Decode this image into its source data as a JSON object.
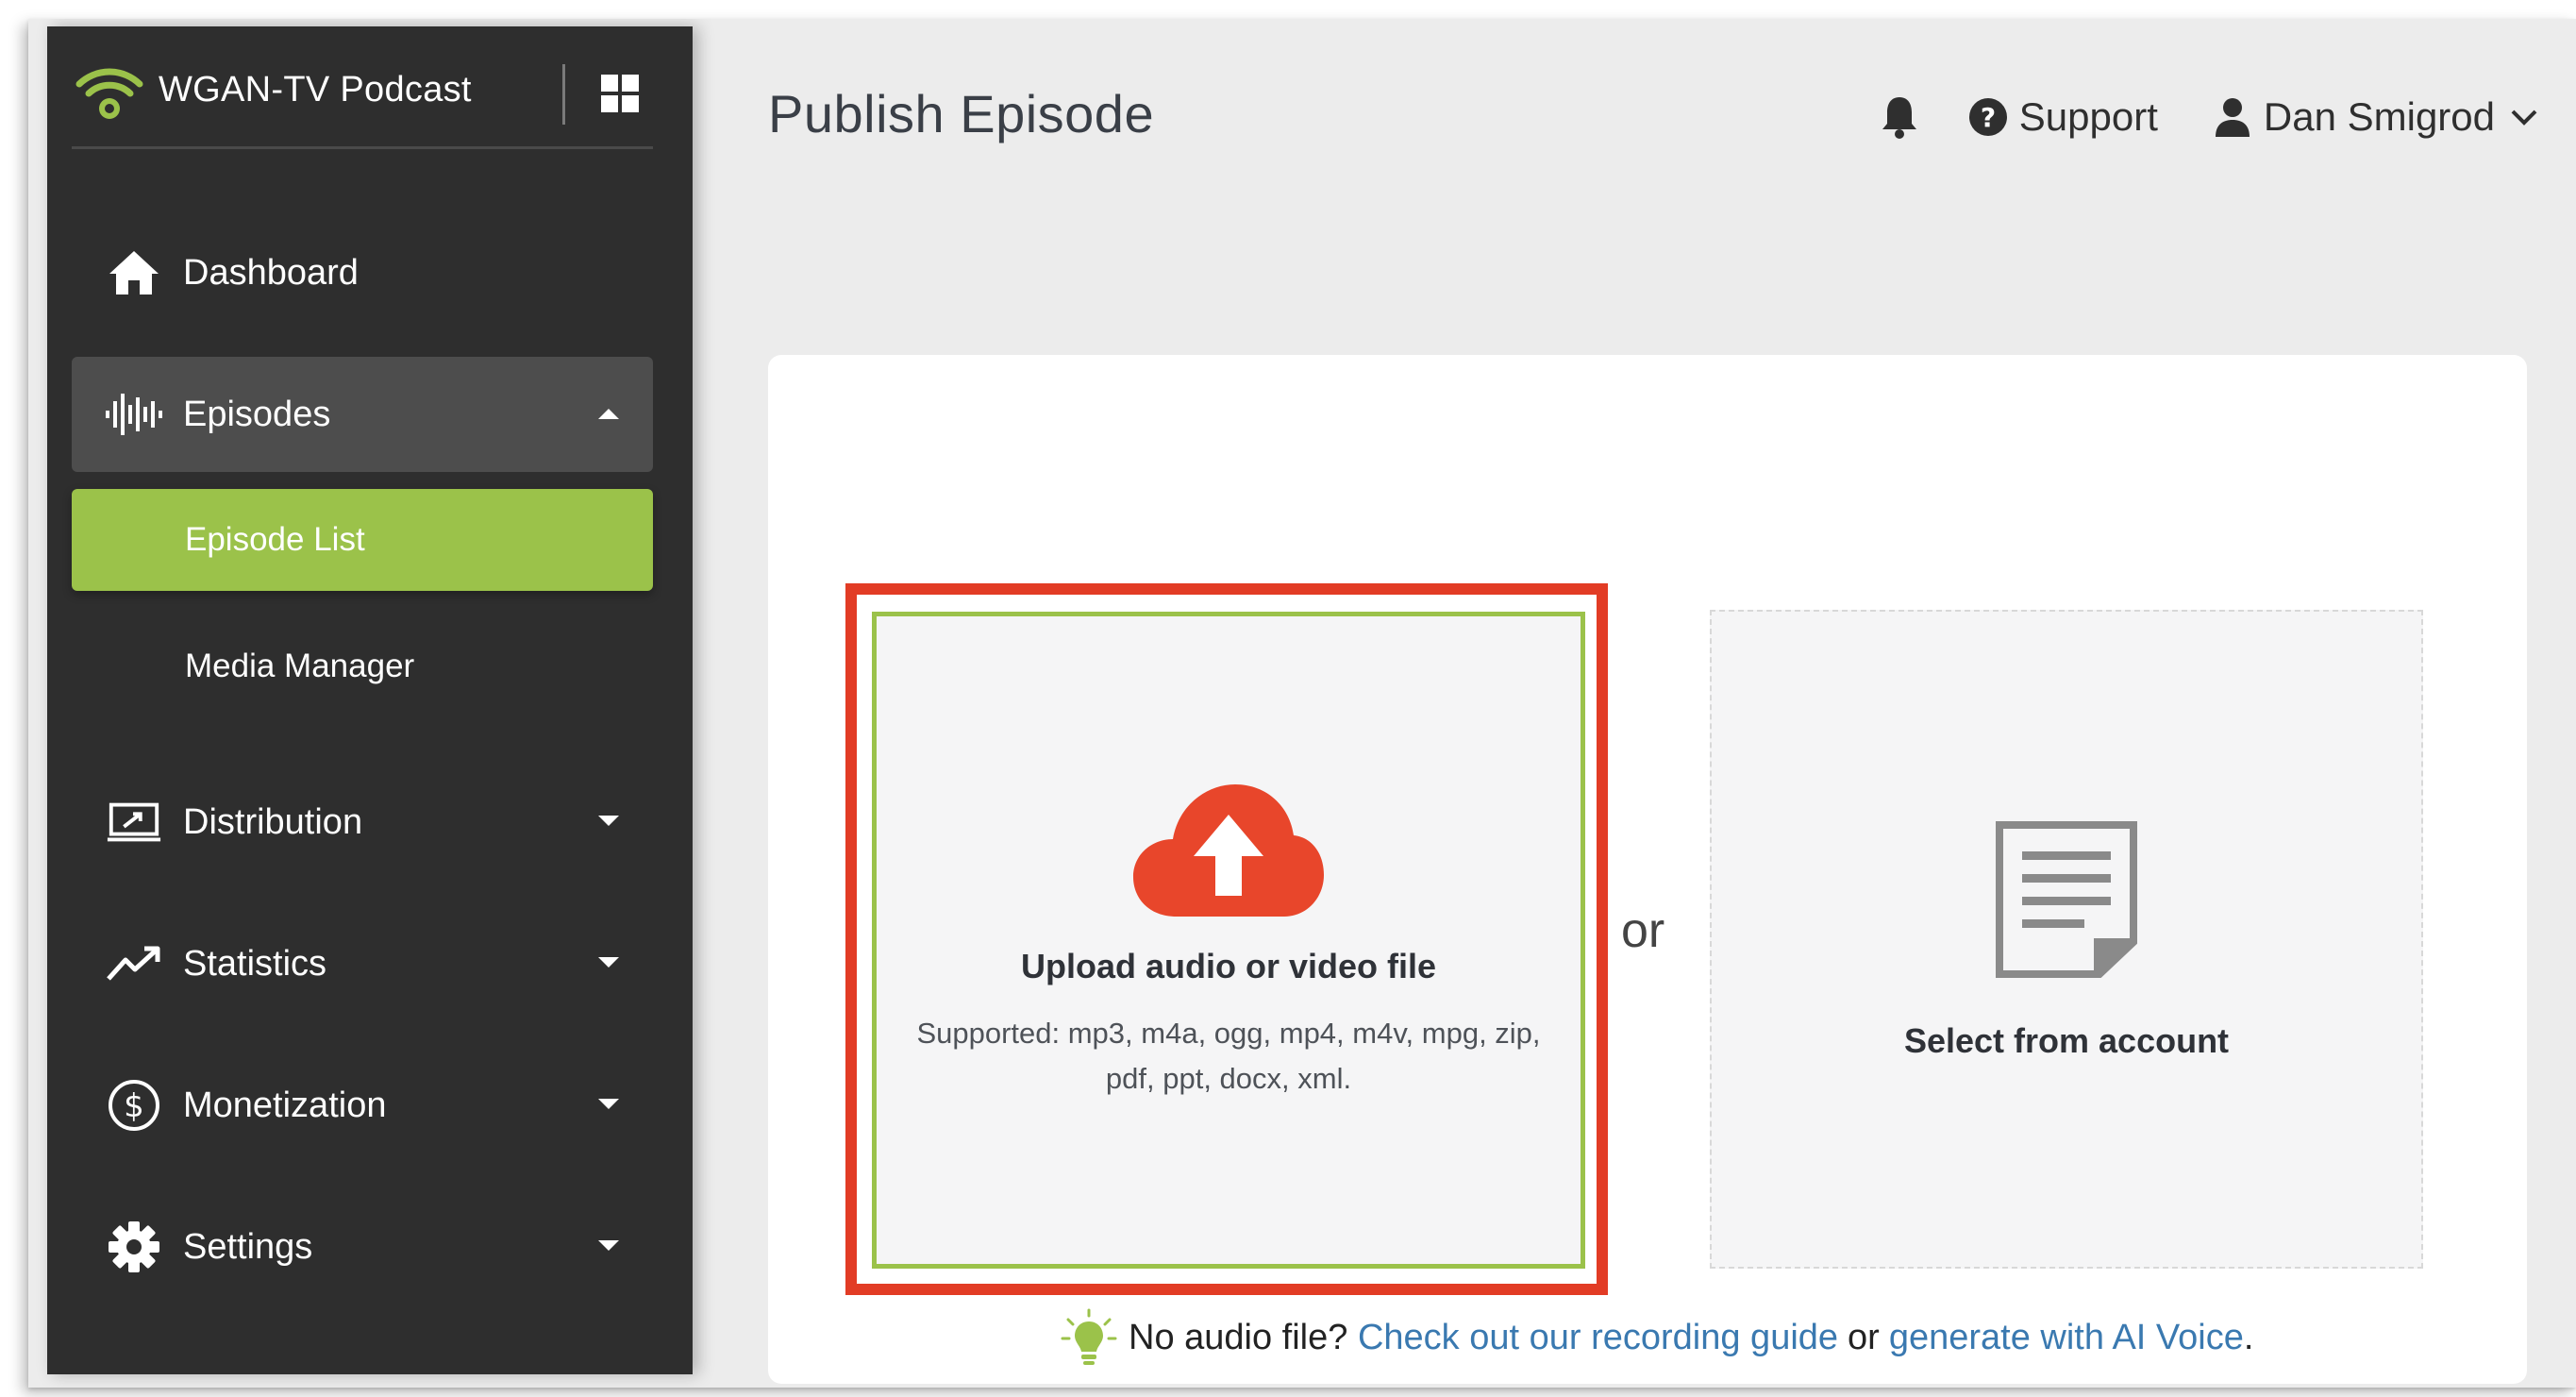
{
  "app": {
    "name": "WGAN-TV Podcast"
  },
  "colors": {
    "accent": "#9bc24a",
    "highlight": "#e23c25",
    "upload_icon": "#e8462b",
    "link": "#3a79b0",
    "sidebar": "#2e2e2e"
  },
  "sidebar": {
    "items": [
      {
        "label": "Dashboard",
        "icon": "home-icon"
      },
      {
        "label": "Episodes",
        "icon": "waveform-icon",
        "expanded": true
      },
      {
        "label": "Episode List",
        "sub": true,
        "active": true
      },
      {
        "label": "Media Manager",
        "sub": true
      },
      {
        "label": "Distribution",
        "icon": "distribution-icon"
      },
      {
        "label": "Statistics",
        "icon": "trend-icon"
      },
      {
        "label": "Monetization",
        "icon": "dollar-icon"
      },
      {
        "label": "Settings",
        "icon": "gear-icon"
      }
    ]
  },
  "header": {
    "title": "Publish Episode",
    "support_label": "Support",
    "user_name": "Dan Smigrod"
  },
  "upload": {
    "title": "Upload audio or video file",
    "supported": "Supported: mp3, m4a, ogg, mp4, m4v, mpg, zip, pdf, ppt, docx, xml."
  },
  "or_label": "or",
  "select": {
    "title": "Select from account"
  },
  "hint": {
    "prefix": "No audio file?",
    "link1": "Check out our recording guide",
    "middle": "or",
    "link2": "generate with AI Voice",
    "suffix": "."
  }
}
